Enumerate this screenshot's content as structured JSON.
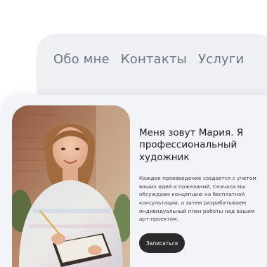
{
  "nav": {
    "items": [
      "Обо мне",
      "Контакты",
      "Услуги"
    ]
  },
  "hero": {
    "title": "Меня зовут Мария. Я профессиональный художник",
    "description": "Каждое произведение создается с учетом ваших идей и пожеланий. Сначала мы обсуждаем концепцию на бесплатной консультации, а затем разрабатываем индивидуальный план работы над вашим арт-проектом.",
    "cta_label": "Записаться"
  },
  "colors": {
    "nav_card": "#eef0f4",
    "main_card": "#f3f4f7",
    "nav_text": "#6d7585",
    "title_text": "#1b1c22",
    "button_bg": "#2a2a2d",
    "button_text": "#ffffff"
  }
}
